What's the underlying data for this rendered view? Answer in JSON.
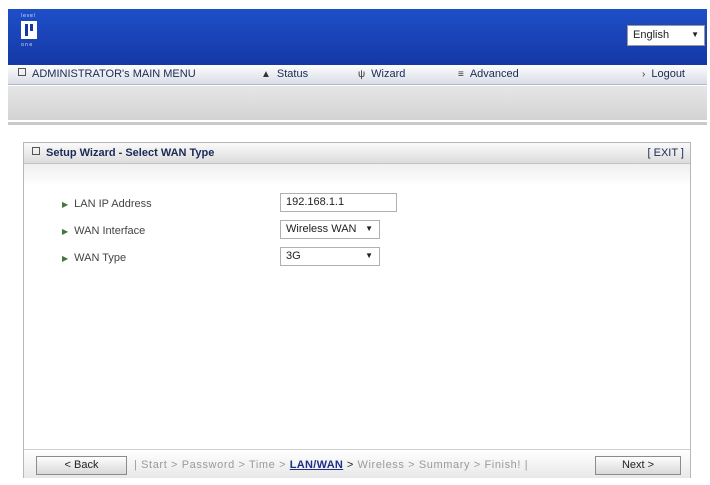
{
  "header": {
    "logo": {
      "top": "level",
      "bottom": "one"
    },
    "language": {
      "selected": "English"
    }
  },
  "menu": {
    "main": "ADMINISTRATOR's MAIN MENU",
    "status": "Status",
    "wizard": "Wizard",
    "advanced": "Advanced",
    "logout": "Logout"
  },
  "panel": {
    "title": "Setup Wizard - Select WAN Type",
    "exit": "[ EXIT ]",
    "fields": [
      {
        "label": "LAN IP Address",
        "value": "192.168.1.1",
        "type": "text"
      },
      {
        "label": "WAN Interface",
        "value": "Wireless WAN",
        "type": "select"
      },
      {
        "label": "WAN Type",
        "value": "3G",
        "type": "select"
      }
    ]
  },
  "nav": {
    "back": "< Back",
    "next": "Next >",
    "steps_open": "|",
    "steps": [
      "Start",
      "Password",
      "Time",
      "LAN/WAN",
      "Wireless",
      "Summary",
      "Finish!"
    ],
    "current_step": "LAN/WAN",
    "separator": ">",
    "steps_close": "|"
  }
}
